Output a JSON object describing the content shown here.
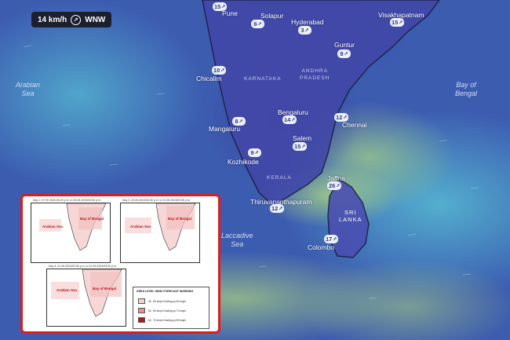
{
  "wind": {
    "speed": "14 km/h",
    "direction": "WNW"
  },
  "cities": [
    {
      "name": "Pune",
      "badge": "15"
    },
    {
      "name": "Solapur",
      "badge": "6"
    },
    {
      "name": "Hyderabad",
      "badge": "3"
    },
    {
      "name": "Visakhapatnam",
      "badge": "15"
    },
    {
      "name": "Guntur",
      "badge": "8"
    },
    {
      "name": "Chicalim",
      "badge": "10"
    },
    {
      "name": "Mangaluru",
      "badge": "8"
    },
    {
      "name": "Bengaluru",
      "badge": "14"
    },
    {
      "name": "Chennai",
      "badge": "12"
    },
    {
      "name": "Salem",
      "badge": "15"
    },
    {
      "name": "Kozhikode",
      "badge": "9"
    },
    {
      "name": "Thiruvananthapuram",
      "badge": "12"
    },
    {
      "name": "Jaffna",
      "badge": "26"
    },
    {
      "name": "Colombo",
      "badge": "17"
    }
  ],
  "regions": {
    "karnataka": "KARNATAKA",
    "andhra": "ANDHRA\nPRADESH",
    "kerala": "KERALA",
    "srilanka": "SRI\nLANKA"
  },
  "seas": {
    "arabian": "Arabian\nSea",
    "bengal": "Bay of\nBengal",
    "laccadive": "Laccadive\nSea"
  },
  "inset": {
    "panels": [
      {
        "title": "Day 1: 07:00 2024-05-20 p.m. to 20-05-2024/03:30 p.m.",
        "arabian": "Arabian Sea",
        "bengal": "Bay of Bengal"
      },
      {
        "title": "Day 2: 20-05-2024/03:30 p.m. to 21-05-2024/03:30 p.m.",
        "arabian": "Arabian Sea",
        "bengal": "Bay of Bengal"
      },
      {
        "title": "Day 3: 21-05-2024/03:30 p.m. to 22-05-2024/03:30 p.m.",
        "arabian": "Arabian Sea",
        "bengal": "Bay of Bengal"
      }
    ],
    "legend": {
      "title": "AREA LEVEL WIND FORECAST WARNING",
      "items": [
        {
          "label": "40 - 50 kmph Gusting up 60 kmph",
          "color": "#f7d0d0"
        },
        {
          "label": "50 - 60 kmph Gusting up 70 kmph",
          "color": "#e89090"
        },
        {
          "label": "60 - 70 kmph Gusting up 80 kmph",
          "color": "#b01818"
        }
      ]
    }
  }
}
